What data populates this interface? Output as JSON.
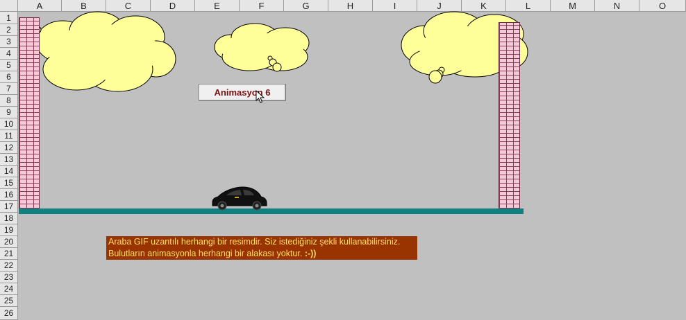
{
  "columns": [
    "A",
    "B",
    "C",
    "D",
    "E",
    "F",
    "G",
    "H",
    "I",
    "J",
    "K",
    "L",
    "M",
    "N",
    "O"
  ],
  "rows": [
    "1",
    "2",
    "3",
    "4",
    "5",
    "6",
    "7",
    "8",
    "9",
    "10",
    "11",
    "12",
    "13",
    "14",
    "15",
    "16",
    "17",
    "18",
    "19",
    "20",
    "21",
    "22",
    "23",
    "24",
    "25",
    "26"
  ],
  "button": {
    "label": "Animasyon 6"
  },
  "note": {
    "line1": "Araba GIF uzantılı herhangi bir resimdir. Siz istediğiniz şekli kullanabilirsiniz.",
    "line2": "Bulutların animasyonla herhangi bir alakası yoktur.",
    "smiley": ":-))"
  },
  "colors": {
    "ground": "#108080",
    "note_bg": "#993300",
    "note_text": "#ffe066",
    "cloud": "#ffff99",
    "brick": "#f4c9d8"
  },
  "icons": [
    "mouse-cursor-icon"
  ]
}
